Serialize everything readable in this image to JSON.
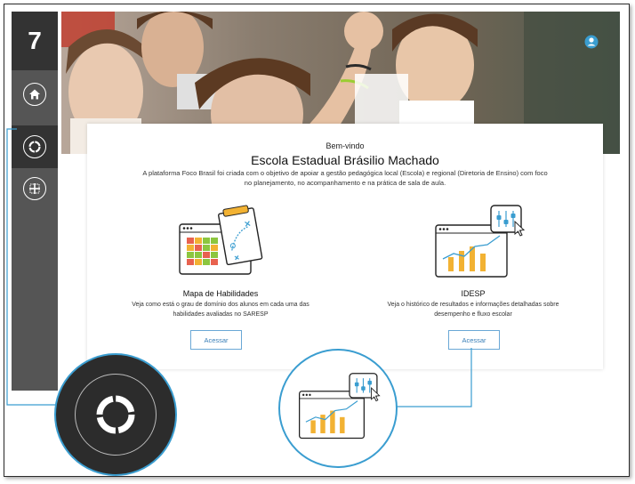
{
  "sidebar": {
    "logo": "7",
    "items": [
      {
        "icon": "home-icon"
      },
      {
        "icon": "circle-progress-icon"
      },
      {
        "icon": "grid-icon"
      }
    ]
  },
  "header": {
    "user_icon": "user-icon"
  },
  "welcome": {
    "greeting": "Bem-vindo",
    "school_name": "Escola Estadual Brásilio Machado",
    "description": "A plataforma Foco Brasil foi criada com o objetivo de apoiar a gestão pedagógica local (Escola) e regional (Diretoria de Ensino) com foco no planejamento, no acompanhamento e na prática de sala de aula."
  },
  "features": [
    {
      "title": "Mapa de Habilidades",
      "description": "Veja como está o grau de domínio dos alunos em cada uma das habilidades avaliadas no SARESP",
      "button": "Acessar"
    },
    {
      "title": "IDESP",
      "description": "Veja o histórico de resultados e informações detalhadas sobre desempenho e fluxo escolar",
      "button": "Acessar"
    }
  ],
  "colors": {
    "accent": "#3a9dd0",
    "sidebar": "#555555",
    "sidebar_dark": "#333333",
    "bar": "#f2b233"
  }
}
